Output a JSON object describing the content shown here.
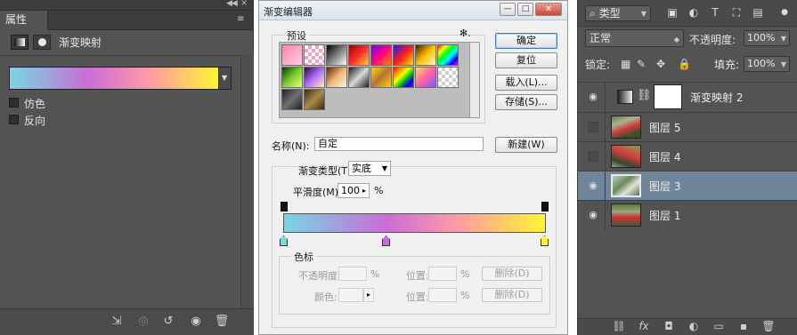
{
  "properties": {
    "tab": "属性",
    "adjustment_title": "渐变映射",
    "options": [
      "仿色",
      "反向"
    ],
    "gradient_colors": [
      "#79d6e3",
      "#c86dd7",
      "#ff99a7",
      "#fff531"
    ]
  },
  "editor": {
    "title": "渐变编辑器",
    "presets_label": "预设",
    "buttons": {
      "ok": "确定",
      "reset": "复位",
      "load": "载入(L)...",
      "save": "存储(S)...",
      "new": "新建(W)"
    },
    "name_label": "名称(N):",
    "name_value": "自定",
    "gradient_type_label": "渐变类型(T):",
    "gradient_type_value": "实底",
    "smoothness_label": "平滑度(M):",
    "smoothness_value": "100",
    "percent": "%",
    "stops_group": "色标",
    "opacity_label": "不透明度:",
    "color_label": "颜色:",
    "location_label": "位置:",
    "delete_label": "删除(D)",
    "stop_colors": {
      "left": "#79d6e3",
      "mid": "#c86dd7",
      "right": "#fff531"
    }
  },
  "layers": {
    "filter_kind": "类型",
    "blend_mode": "正常",
    "opacity_label": "不透明度:",
    "opacity_value": "100%",
    "lock_label": "锁定:",
    "fill_label": "填充:",
    "fill_value": "100%",
    "items": [
      {
        "name": "渐变映射 2",
        "visible": true,
        "selected": false
      },
      {
        "name": "图层 5",
        "visible": false,
        "selected": false
      },
      {
        "name": "图层 4",
        "visible": false,
        "selected": false
      },
      {
        "name": "图层 3",
        "visible": true,
        "selected": true
      },
      {
        "name": "图层 1",
        "visible": true,
        "selected": false
      }
    ]
  },
  "icons": {
    "eye": "eye-icon",
    "link": "link-icon",
    "fx": "fx-icon",
    "trash": "trash-icon"
  },
  "preset_swatches": [
    "linear-gradient(135deg,#ff7fae,#ffd0e0)",
    "repeating-conic-gradient(#f8a0c0 0 25%,#ffffff 0 50%) 0 0/8px 8px",
    "linear-gradient(135deg,#000,#fff)",
    "linear-gradient(135deg,#9a0000,#ff2d2d,#ffcf2f)",
    "linear-gradient(135deg,#7a00ff,#ff0080,#ff8c00)",
    "linear-gradient(135deg,#1a1aff,#ff1a1a,#ffe600)",
    "linear-gradient(135deg,#3d1f00,#ffbf00,#fff8cf)",
    "linear-gradient(135deg,#ff0000,#ffff00,#00ff00,#00ffff,#0000ff,#ff00ff)",
    "linear-gradient(135deg,#003d00,#7bcf2a,#e8ff8a)",
    "linear-gradient(135deg,#2a0a40,#b36cff,#fff3a0)",
    "linear-gradient(135deg,#5a2200,#f0b87a,#fff2e0)",
    "linear-gradient(135deg,#1d1d1d,#d9d9d9,#1d1d1d)",
    "linear-gradient(135deg,#ffd700,#b87333,#ffd700)",
    "linear-gradient(135deg,#ff0000,#ff8800,#ffff00,#00cc00,#0000ff,#8800ff)",
    "linear-gradient(135deg,#ffde59,#ff5ea8,#7a5cff)",
    "repeating-conic-gradient(#d0d0d0 0 25%,#ffffff 0 50%) 0 0/8px 8px",
    "linear-gradient(135deg,#202020,#707070,#202020)",
    "linear-gradient(135deg,#3b2a10,#a88a4a,#3b2a10)"
  ]
}
